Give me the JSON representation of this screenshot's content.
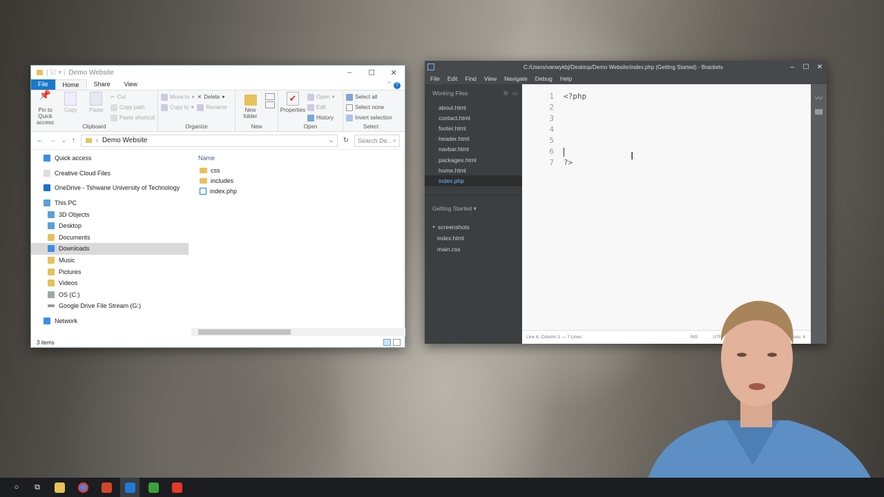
{
  "explorer": {
    "title": "Demo Website",
    "tabs": [
      "File",
      "Home",
      "Share",
      "View"
    ],
    "ribbon": {
      "clipboard": {
        "pin": "Pin to Quick access",
        "copy": "Copy",
        "paste": "Paste",
        "cut": "Cut",
        "copy_path": "Copy path",
        "paste_shortcut": "Paste shortcut",
        "caption": "Clipboard"
      },
      "organize": {
        "move_to": "Move to",
        "copy_to": "Copy to",
        "delete": "Delete",
        "rename": "Rename",
        "caption": "Organize"
      },
      "new": {
        "new_folder": "New folder",
        "caption": "New"
      },
      "open": {
        "properties": "Properties",
        "open": "Open",
        "edit": "Edit",
        "history": "History",
        "caption": "Open"
      },
      "select": {
        "select_all": "Select all",
        "select_none": "Select none",
        "invert": "Invert selection",
        "caption": "Select"
      }
    },
    "address": "Demo Website",
    "search_placeholder": "Search De...",
    "nav": [
      {
        "label": "Quick access",
        "color": "#3b8ee6"
      },
      {
        "label": "Creative Cloud Files",
        "color": "#e0e0e0"
      },
      {
        "label": "OneDrive - Tshwane University of Technology",
        "color": "#1a73c9"
      },
      {
        "label": "This PC",
        "color": "#5aa0d8"
      },
      {
        "label": "3D Objects",
        "color": "#5aa0d8"
      },
      {
        "label": "Desktop",
        "color": "#5aa0d8"
      },
      {
        "label": "Documents",
        "color": "#e8c15a"
      },
      {
        "label": "Downloads",
        "color": "#3b8ee6"
      },
      {
        "label": "Music",
        "color": "#e8c15a"
      },
      {
        "label": "Pictures",
        "color": "#e8c15a"
      },
      {
        "label": "Videos",
        "color": "#e8c15a"
      },
      {
        "label": "OS (C:)",
        "color": "#9aa"
      },
      {
        "label": "Google Drive File Stream (G:)",
        "color": "#999"
      },
      {
        "label": "Network",
        "color": "#3b8ee6"
      }
    ],
    "column_name": "Name",
    "files": [
      "css",
      "includes",
      "index.php"
    ],
    "status": "3 items"
  },
  "brackets": {
    "title": "C:/Users/vanwykbj/Desktop/Demo Website/index.php (Getting Started) - Brackets",
    "menu": [
      "File",
      "Edit",
      "Find",
      "View",
      "Navigate",
      "Debug",
      "Help"
    ],
    "working_files_label": "Working Files",
    "working_files": [
      "about.html",
      "contact.html",
      "footer.html",
      "header.html",
      "navbar.html",
      "packages.html",
      "home.html",
      "index.php"
    ],
    "project_label": "Getting Started",
    "project_files": [
      "screenshots",
      "index.html",
      "main.css"
    ],
    "line_numbers": [
      "1",
      "2",
      "3",
      "4",
      "5",
      "6",
      "7"
    ],
    "code_lines": [
      "<?php",
      "",
      "",
      "",
      "",
      "",
      "?>"
    ],
    "status_left": "Line 6, Column 1 — 7 Lines",
    "status_ins": "INS",
    "status_enc": "UTF",
    "status_spaces": "aces: 4"
  },
  "taskbar": {
    "apps": [
      {
        "name": "file-explorer",
        "color": "#e8c15a"
      },
      {
        "name": "chrome",
        "color": "#4285f4"
      },
      {
        "name": "powerpoint",
        "color": "#d24726"
      },
      {
        "name": "brackets",
        "color": "#1f7ad8"
      },
      {
        "name": "camtasia",
        "color": "#3aa33a"
      },
      {
        "name": "recorder",
        "color": "#e53a2a"
      }
    ]
  }
}
